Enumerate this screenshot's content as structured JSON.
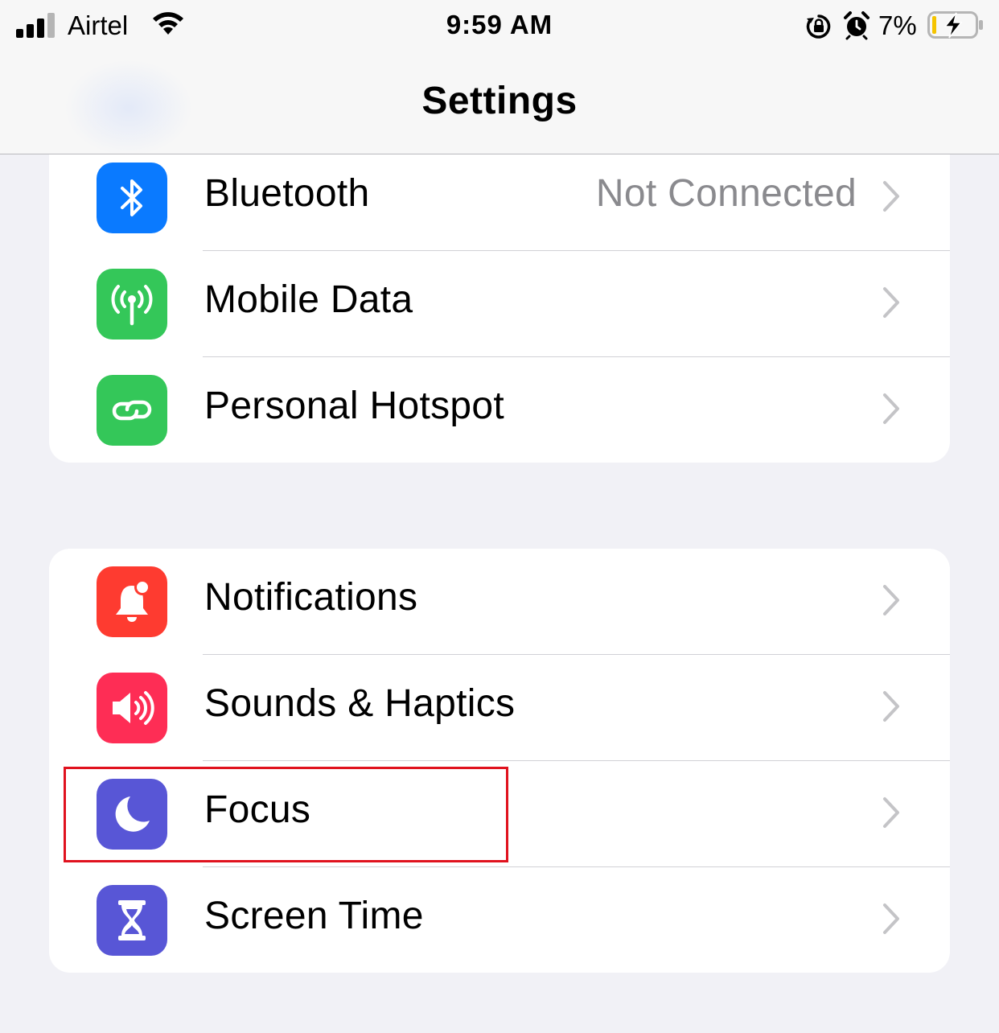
{
  "status_bar": {
    "carrier": "Airtel",
    "time": "9:59 AM",
    "battery_percent": "7%",
    "icons": [
      "signal-icon",
      "wifi-icon",
      "rotation-lock-icon",
      "alarm-icon",
      "battery-charging-icon"
    ]
  },
  "nav": {
    "title": "Settings"
  },
  "groups": [
    {
      "rows": [
        {
          "label": "Bluetooth",
          "value": "Not Connected",
          "icon": "bluetooth-icon",
          "color": "#0a7aff"
        },
        {
          "label": "Mobile Data",
          "icon": "antenna-icon",
          "color": "#34c759"
        },
        {
          "label": "Personal Hotspot",
          "icon": "hotspot-chain-icon",
          "color": "#34c759"
        }
      ]
    },
    {
      "rows": [
        {
          "label": "Notifications",
          "icon": "bell-icon",
          "color": "#fe3b30"
        },
        {
          "label": "Sounds & Haptics",
          "icon": "speaker-icon",
          "color": "#fe2d55"
        },
        {
          "label": "Focus",
          "icon": "moon-icon",
          "color": "#5856d6"
        },
        {
          "label": "Screen Time",
          "icon": "hourglass-icon",
          "color": "#5856d6"
        }
      ]
    }
  ],
  "highlight": {
    "target": "Focus",
    "color": "#e0121e"
  }
}
